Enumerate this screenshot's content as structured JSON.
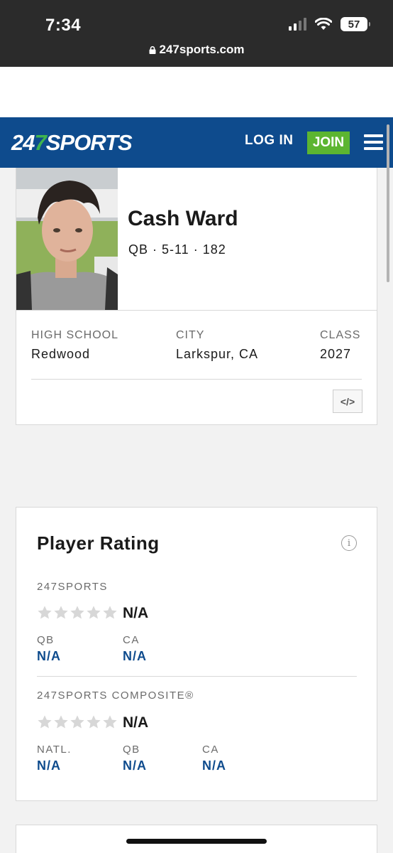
{
  "status_bar": {
    "time": "7:34",
    "battery": "57",
    "url": "247sports.com"
  },
  "header": {
    "logo_prefix": "24",
    "logo_seven": "7",
    "logo_suffix": "SPORTS",
    "login_label": "LOG IN",
    "join_label": "JOIN",
    "brand_color": "#0e4b8d",
    "join_color": "#5cb531"
  },
  "player": {
    "name": "Cash Ward",
    "meta": "QB · 5-11 · 182",
    "info": [
      {
        "label": "HIGH SCHOOL",
        "value": "Redwood"
      },
      {
        "label": "CITY",
        "value": "Larkspur, CA"
      },
      {
        "label": "CLASS",
        "value": "2027"
      }
    ],
    "embed_label": "</>"
  },
  "rating": {
    "title": "Player Rating",
    "info_icon": "i",
    "sports247": {
      "label": "247SPORTS",
      "stars_value": "N/A",
      "stars_filled": 0,
      "ranks": [
        {
          "label": "QB",
          "value": "N/A"
        },
        {
          "label": "CA",
          "value": "N/A"
        }
      ]
    },
    "composite": {
      "label": "247SPORTS COMPOSITE®",
      "stars_value": "N/A",
      "stars_filled": 0,
      "ranks": [
        {
          "label": "NATL.",
          "value": "N/A"
        },
        {
          "label": "QB",
          "value": "N/A"
        },
        {
          "label": "CA",
          "value": "N/A"
        }
      ]
    }
  }
}
